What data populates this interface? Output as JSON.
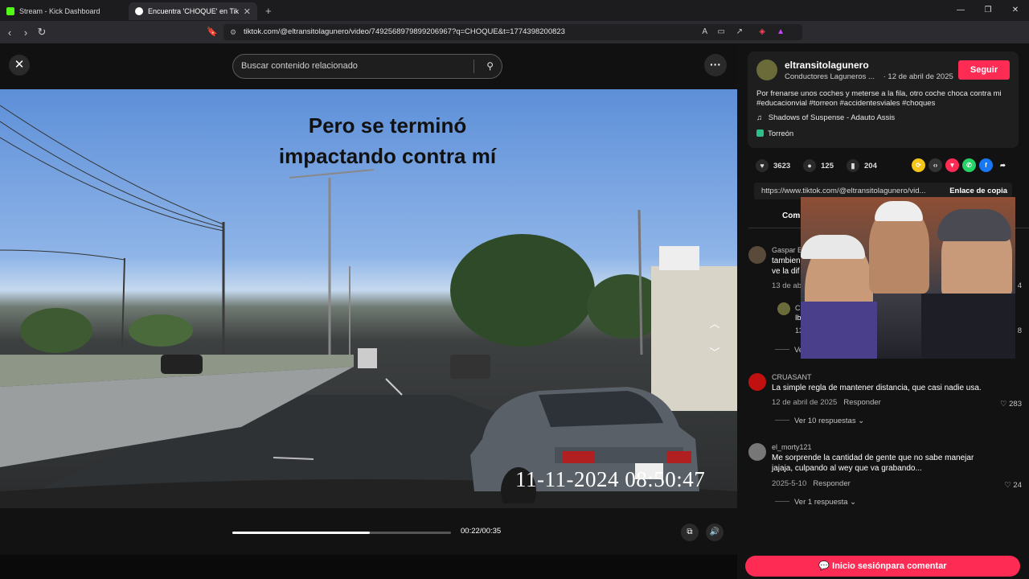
{
  "browser": {
    "tabs": [
      {
        "title": "Stream - Kick Dashboard",
        "color": "#53fc18"
      },
      {
        "title": "Encuentra 'CHOQUE' en TikTok",
        "color": "#ffffff"
      }
    ],
    "url": "tiktok.com/@eltransitolagunero/video/7492568979899206967?q=CHOQUE&t=1774398200823"
  },
  "top": {
    "search_placeholder": "Buscar contenido relacionado"
  },
  "video": {
    "caption_line1": "Pero se terminó",
    "caption_line2": "impactando contra mí",
    "timestamp": "11-11-2024 08:50:47",
    "time_display": "00:22/00:35",
    "progress": 0.63
  },
  "author": {
    "username": "eltransitolagunero",
    "nickname": "Conductores Laguneros ...",
    "date": "· 12 de abril de 2025",
    "follow_label": "Seguir",
    "description": "Por frenarse unos coches y meterse a la fila, otro coche choca contra mi #educacionvial #torreon #accidentesviales #choques",
    "music": "Shadows of Suspense - Adauto Assis",
    "location": "Torreón"
  },
  "stats": {
    "likes": "3623",
    "comments": "125",
    "saves": "204"
  },
  "link": {
    "url": "https://www.tiktok.com/@eltransitolagunero/vid...",
    "copy_label": "Enlace de copia"
  },
  "tabs": {
    "comments_label": "Com"
  },
  "comments": [
    {
      "name": "Gaspar B",
      "text": "tambien\nve la dif",
      "date": "13 de abr",
      "avatar": "#5a4a3a"
    },
    {
      "name": "CRUASANT",
      "text": "La simple regla de mantener distancia, que casi nadie usa.",
      "date": "12 de abril de 2025",
      "reply": "Responder",
      "likes": "283",
      "replies": "Ver 10 respuestas",
      "avatar": "#c01010"
    },
    {
      "name": "el_morty121",
      "text": "Me sorprende la cantidad de gente que no sabe manejar jajaja, culpando al wey que va grabando...",
      "date": "2025-5-10",
      "reply": "Responder",
      "likes": "24",
      "replies": "Ver 1 respuesta",
      "avatar": "#777777"
    }
  ],
  "partial": {
    "reply_prefix": "Ve",
    "reply_count_1": "4",
    "reply_count_2": "8",
    "reply_date": "13",
    "reply_name": "C",
    "reply_text": "Ib"
  },
  "footer": {
    "login_label": "Inicio sesiónpara comentar"
  }
}
